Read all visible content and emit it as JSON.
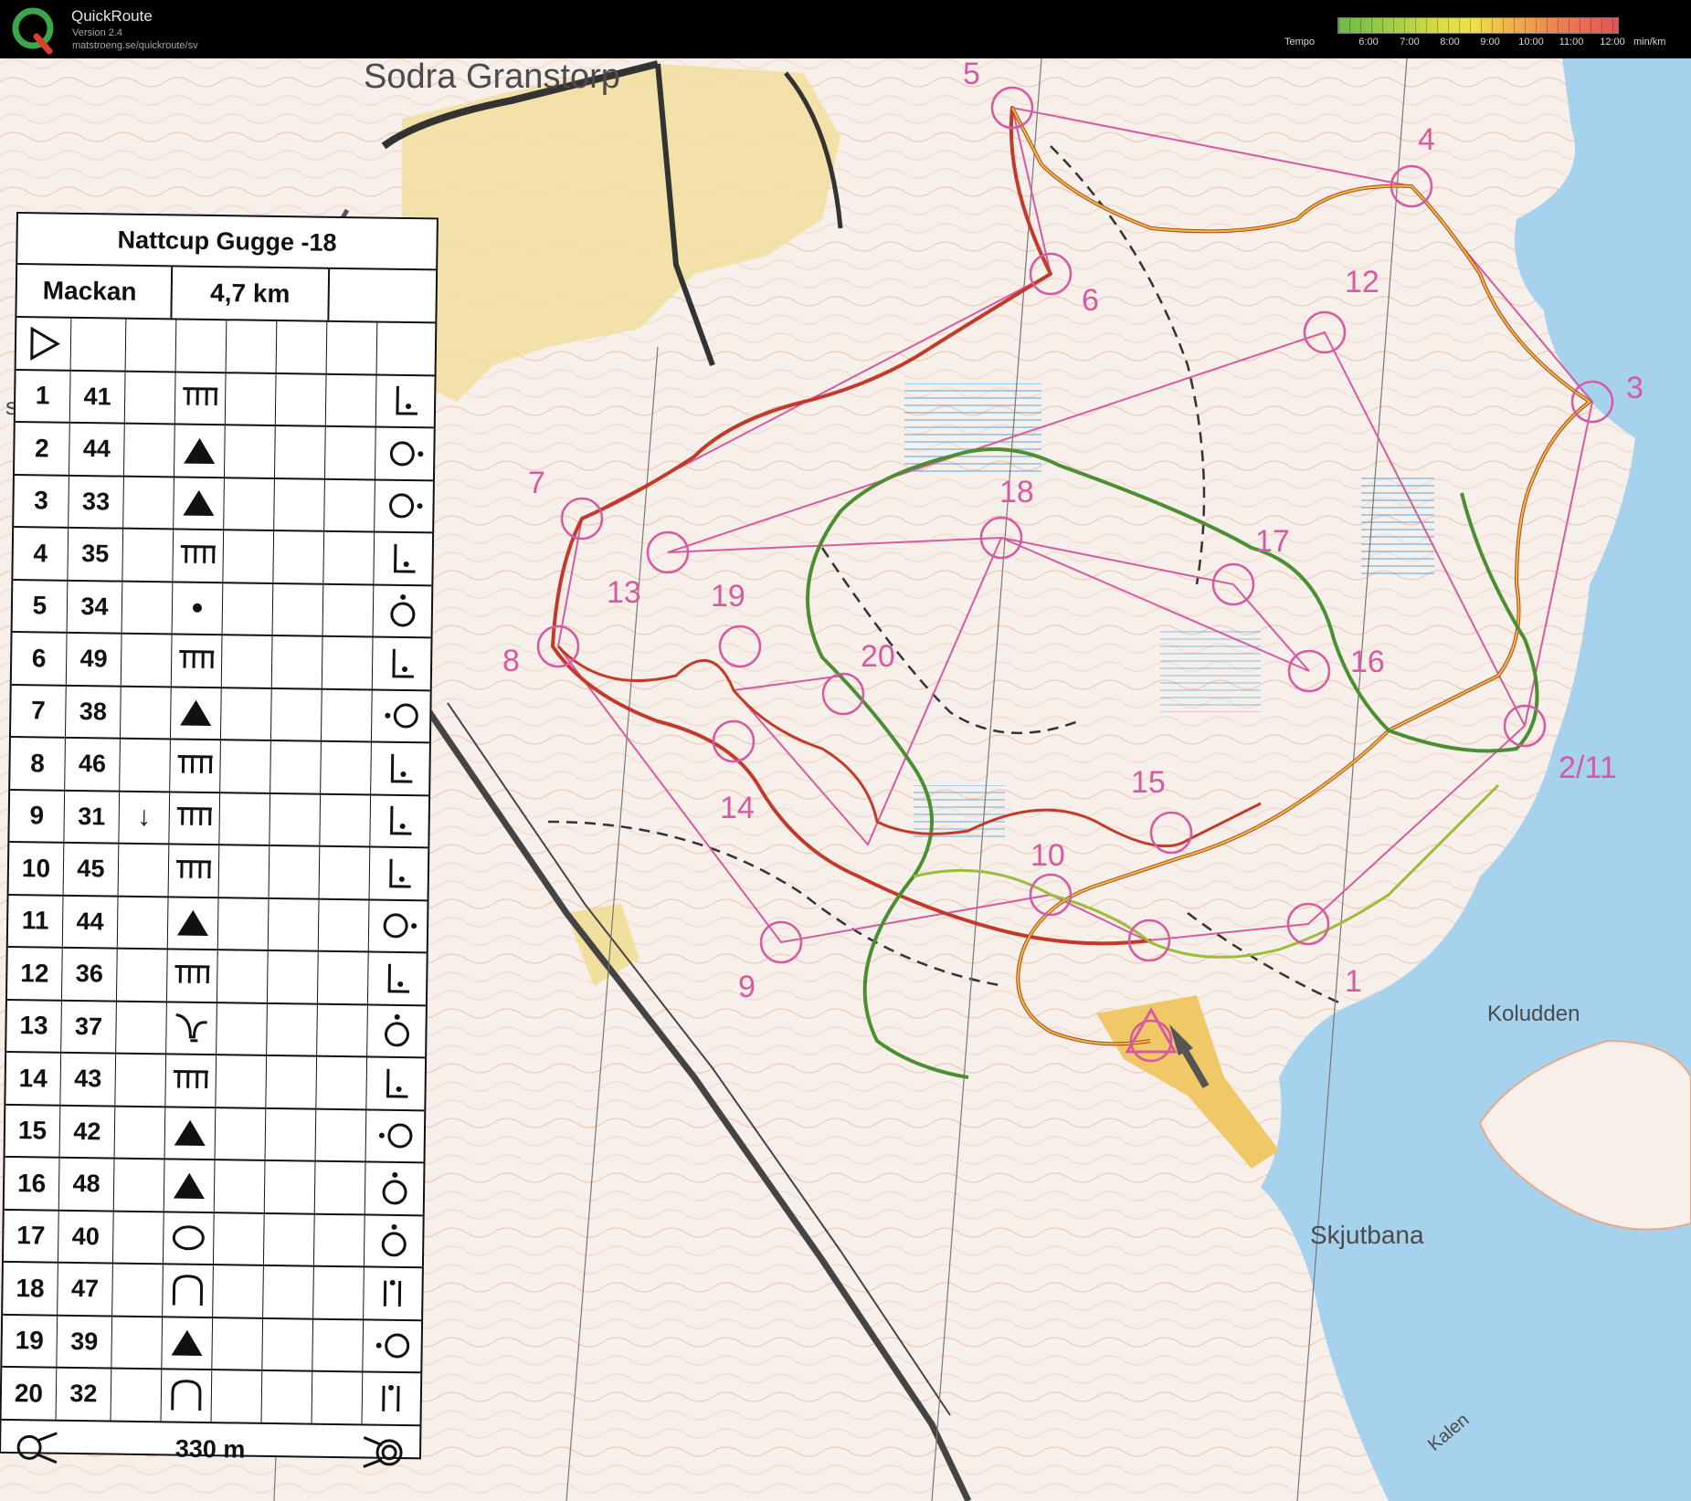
{
  "app": {
    "name": "QuickRoute",
    "version": "Version 2.4",
    "url": "matstroeng.se/quickroute/sv",
    "logo_letter": "Q"
  },
  "legend": {
    "label": "Tempo",
    "ticks": [
      "6:00",
      "7:00",
      "8:00",
      "9:00",
      "10:00",
      "11:00",
      "12:00"
    ],
    "unit": "min/km",
    "colors": [
      "#6aba4a",
      "#d7dc45",
      "#f0b04a",
      "#e5525a"
    ]
  },
  "map_labels": {
    "sodra": "Sodra Granstorp",
    "kol": "Koludden",
    "skjut": "Skjutbana",
    "kalen": "Kalen",
    "se": "se"
  },
  "controls": {
    "c1": "1",
    "c211": "2/11",
    "c3": "3",
    "c4": "4",
    "c5": "5",
    "c6": "6",
    "c7": "7",
    "c8": "8",
    "c9": "9",
    "c10": "10",
    "c12": "12",
    "c13": "13",
    "c14": "14",
    "c15": "15",
    "c16": "16",
    "c17": "17",
    "c18": "18",
    "c19": "19",
    "c20": "20"
  },
  "description": {
    "title": "Nattcup Gugge -18",
    "runner": "Mackan",
    "distance": "4,7 km",
    "rows": [
      {
        "n": "1",
        "code": "41",
        "dir": "",
        "feature": "terrace",
        "where": "corner"
      },
      {
        "n": "2",
        "code": "44",
        "dir": "",
        "feature": "boulder",
        "where": "east-side"
      },
      {
        "n": "3",
        "code": "33",
        "dir": "",
        "feature": "boulder",
        "where": "east-side"
      },
      {
        "n": "4",
        "code": "35",
        "dir": "",
        "feature": "terrace",
        "where": "corner"
      },
      {
        "n": "5",
        "code": "34",
        "dir": "",
        "feature": "dot",
        "where": "north-side"
      },
      {
        "n": "6",
        "code": "49",
        "dir": "",
        "feature": "terrace",
        "where": "corner"
      },
      {
        "n": "7",
        "code": "38",
        "dir": "",
        "feature": "boulder",
        "where": "west-side"
      },
      {
        "n": "8",
        "code": "46",
        "dir": "",
        "feature": "terrace",
        "where": "corner"
      },
      {
        "n": "9",
        "code": "31",
        "dir": "↓",
        "feature": "terrace",
        "where": "corner"
      },
      {
        "n": "10",
        "code": "45",
        "dir": "",
        "feature": "terrace",
        "where": "corner"
      },
      {
        "n": "11",
        "code": "44",
        "dir": "",
        "feature": "boulder",
        "where": "east-side"
      },
      {
        "n": "12",
        "code": "36",
        "dir": "",
        "feature": "terrace",
        "where": "corner"
      },
      {
        "n": "13",
        "code": "37",
        "dir": "",
        "feature": "reentrant",
        "where": "north-side"
      },
      {
        "n": "14",
        "code": "43",
        "dir": "",
        "feature": "terrace",
        "where": "corner"
      },
      {
        "n": "15",
        "code": "42",
        "dir": "",
        "feature": "boulder",
        "where": "west-side"
      },
      {
        "n": "16",
        "code": "48",
        "dir": "",
        "feature": "boulder",
        "where": "north-side"
      },
      {
        "n": "17",
        "code": "40",
        "dir": "",
        "feature": "pit",
        "where": "north-side"
      },
      {
        "n": "18",
        "code": "47",
        "dir": "",
        "feature": "knoll",
        "where": "top"
      },
      {
        "n": "19",
        "code": "39",
        "dir": "",
        "feature": "boulder",
        "where": "west-side"
      },
      {
        "n": "20",
        "code": "32",
        "dir": "",
        "feature": "knoll",
        "where": "top"
      }
    ],
    "finish_distance": "330 m"
  }
}
